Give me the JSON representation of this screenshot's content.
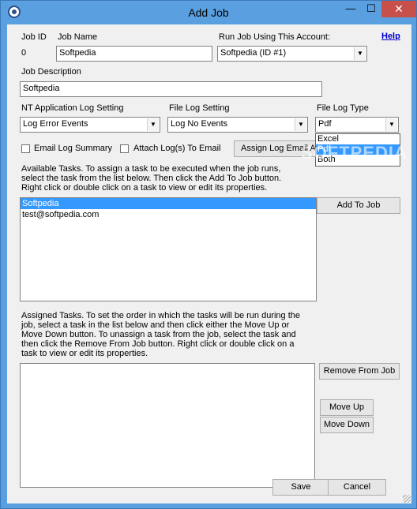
{
  "window": {
    "title": "Add Job",
    "minimize": "—",
    "maximize": "☐",
    "close": "✕"
  },
  "job": {
    "id_label": "Job ID",
    "id_value": "0",
    "name_label": "Job Name",
    "name_value": "Softpedia",
    "account_label": "Run Job Using This Account:",
    "account_value": "Softpedia  (ID #1)",
    "help_label": "Help",
    "description_label": "Job Description",
    "description_value": "Softpedia"
  },
  "logging": {
    "nt_label": "NT Application Log Setting",
    "nt_value": "Log Error Events",
    "file_label": "File Log Setting",
    "file_value": "Log No Events",
    "type_label": "File Log Type",
    "type_value": "Pdf",
    "type_options": [
      "Excel",
      "Pdf",
      "Both"
    ],
    "email_summary_label": "Email Log Summary",
    "attach_logs_label": "Attach Log(s) To Email",
    "assign_email_label": "Assign Log Email A"
  },
  "available": {
    "instructions": "Available Tasks. To assign a task to be executed when the job runs, select the task from the list below. Then click the Add To Job button. Right click or double click on a task to view or edit its properties.",
    "items": [
      "Softpedia",
      "test@softpedia.com"
    ],
    "add_button": "Add To Job"
  },
  "assigned": {
    "instructions": "Assigned Tasks. To set the order in which the tasks will be run during the job, select a task in the list below and then click either the Move Up or Move Down button. To unassign a task from the job, select the task and then click the Remove From Job button. Right click or double click on a task to view or edit its properties.",
    "remove_button": "Remove From Job",
    "move_up_button": "Move Up",
    "move_down_button": "Move Down"
  },
  "footer": {
    "save_button": "Save",
    "cancel_button": "Cancel"
  },
  "watermark": "SOFTPEDIA",
  "colors": {
    "titlebar": "#5aa0e0",
    "close": "#c7504b",
    "selection": "#3399ff",
    "link": "#0000c8"
  }
}
